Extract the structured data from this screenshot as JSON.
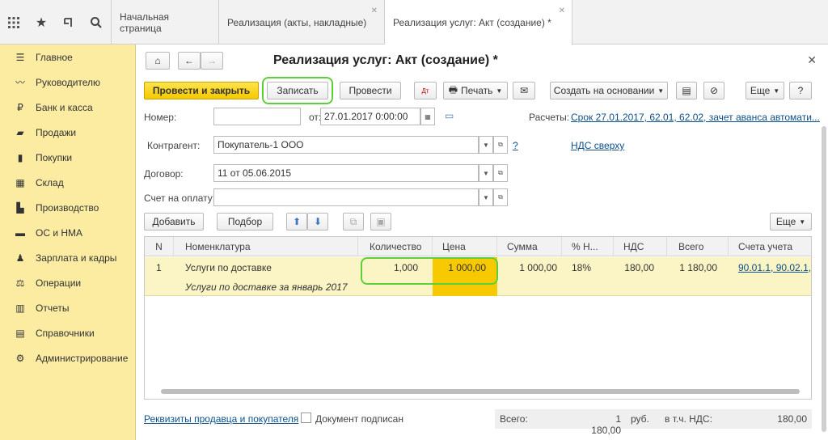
{
  "tabs": [
    {
      "label": "Начальная страница"
    },
    {
      "label": "Реализация (акты, накладные)"
    },
    {
      "label": "Реализация услуг: Акт (создание) *"
    }
  ],
  "sidebar": {
    "items": [
      {
        "label": "Главное",
        "icon": "menu-icon"
      },
      {
        "label": "Руководителю",
        "icon": "chart-line-icon"
      },
      {
        "label": "Банк и касса",
        "icon": "ruble-icon"
      },
      {
        "label": "Продажи",
        "icon": "bag-icon"
      },
      {
        "label": "Покупки",
        "icon": "cart-icon"
      },
      {
        "label": "Склад",
        "icon": "warehouse-icon"
      },
      {
        "label": "Производство",
        "icon": "factory-icon"
      },
      {
        "label": "ОС и НМА",
        "icon": "truck-icon"
      },
      {
        "label": "Зарплата и кадры",
        "icon": "person-icon"
      },
      {
        "label": "Операции",
        "icon": "operations-icon"
      },
      {
        "label": "Отчеты",
        "icon": "bar-chart-icon"
      },
      {
        "label": "Справочники",
        "icon": "book-icon"
      },
      {
        "label": "Администрирование",
        "icon": "gear-icon"
      }
    ]
  },
  "form": {
    "title": "Реализация услуг: Акт (создание) *",
    "buttons": {
      "post_close": "Провести и закрыть",
      "save": "Записать",
      "post": "Провести",
      "print": "Печать",
      "create_based": "Создать на основании",
      "more": "Еще",
      "help": "?",
      "add": "Добавить",
      "pick": "Подбор",
      "table_more": "Еще"
    },
    "labels": {
      "number": "Номер:",
      "from": "от:",
      "counterparty": "Контрагент:",
      "contract": "Договор:",
      "invoice": "Счет на оплату:",
      "settlements": "Расчеты:"
    },
    "fields": {
      "number": "",
      "date": "27.01.2017  0:00:00",
      "counterparty": "Покупатель-1 ООО",
      "contract": "11 от 05.06.2015",
      "invoice": ""
    },
    "links": {
      "settlements": "Срок 27.01.2017, 62.01, 62.02, зачет аванса автомати...",
      "vat_on_top": "НДС сверху",
      "question": "?",
      "seller_buyer": "Реквизиты продавца и покупателя"
    },
    "signed_label": "Документ подписан"
  },
  "table": {
    "headers": [
      "N",
      "Номенклатура",
      "Количество",
      "Цена",
      "Сумма",
      "% Н...",
      "НДС",
      "Всего",
      "Счета учета"
    ],
    "rows": [
      {
        "n": "1",
        "item": "Услуги по доставке",
        "content": "Услуги по доставке за январь 2017",
        "qty": "1,000",
        "price": "1 000,00",
        "sum": "1 000,00",
        "vat_rate": "18%",
        "vat": "180,00",
        "total": "1 180,00",
        "accounts": "90.01.1, 90.02.1, ..."
      }
    ]
  },
  "totals": {
    "total_label": "Всего:",
    "total_value": "1 180,00",
    "currency": "руб.",
    "vat_label": "в т.ч. НДС:",
    "vat_value": "180,00"
  }
}
